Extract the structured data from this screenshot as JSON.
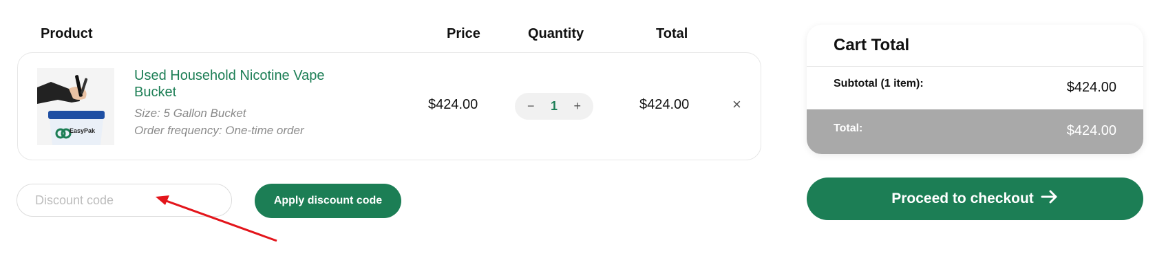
{
  "table": {
    "headers": {
      "product": "Product",
      "price": "Price",
      "quantity": "Quantity",
      "total": "Total"
    }
  },
  "cart": {
    "items": [
      {
        "name": "Used Household Nicotine Vape Bucket",
        "image_label": "EasyPak",
        "size": "Size: 5 Gallon Bucket",
        "frequency": "Order frequency: One-time order",
        "price": "$424.00",
        "quantity": "1",
        "total": "$424.00",
        "decrement": "−",
        "increment": "+",
        "remove": "×"
      }
    ]
  },
  "discount": {
    "placeholder": "Discount code",
    "value": "",
    "apply_label": "Apply discount code"
  },
  "summary": {
    "title": "Cart Total",
    "subtotal_label": "Subtotal (1 item):",
    "subtotal_value": "$424.00",
    "total_label": "Total:",
    "total_value": "$424.00",
    "checkout_label": "Proceed to checkout"
  },
  "colors": {
    "brand_green": "#1c7e55",
    "total_band": "#a9a9a9",
    "annotation_red": "#e3151b"
  },
  "icons": {
    "checkout_arrow": "arrow-right-icon",
    "annotation": "red-arrow-pointer"
  }
}
